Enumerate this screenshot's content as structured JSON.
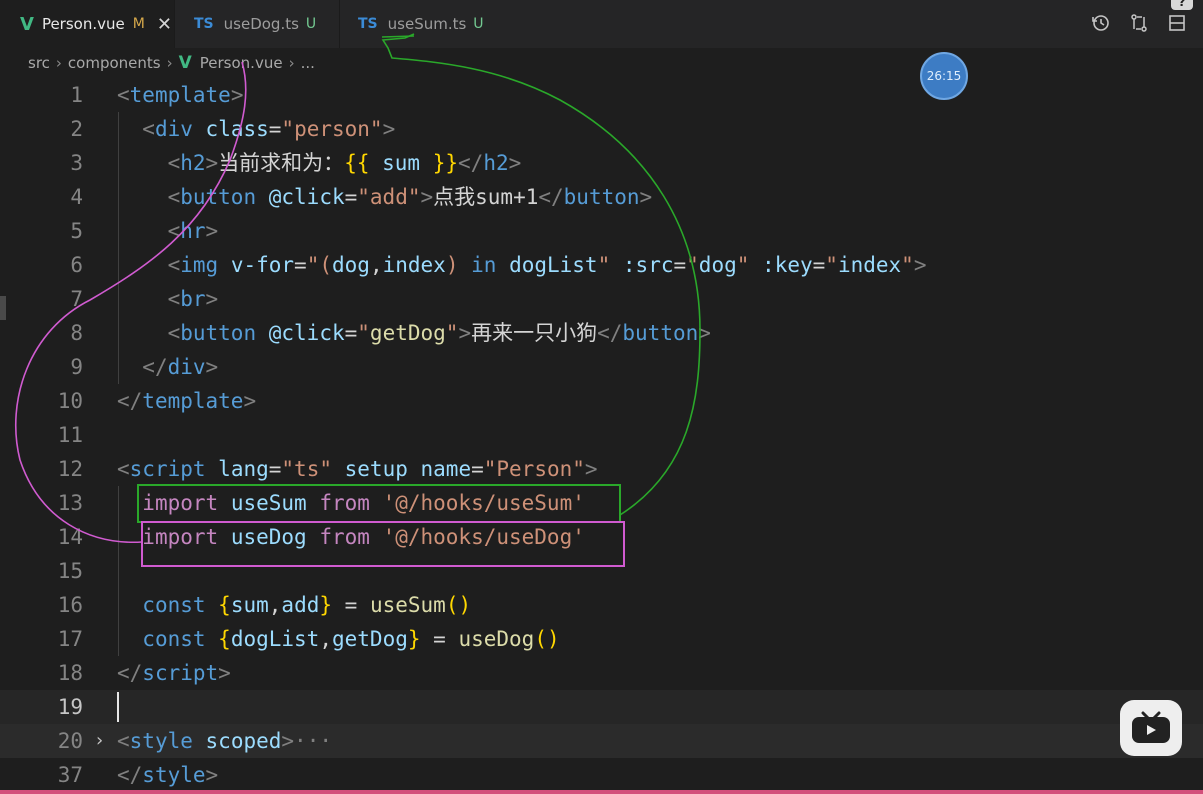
{
  "tabs": [
    {
      "icon": "V",
      "label": "Person.vue",
      "status": "M",
      "close": "✕",
      "active": true
    },
    {
      "icon": "TS",
      "label": "useDog.ts",
      "status": "U",
      "active": false
    },
    {
      "icon": "TS",
      "label": "useSum.ts",
      "status": "U",
      "active": false
    }
  ],
  "breadcrumb": {
    "parts": [
      "src",
      "components"
    ],
    "file_icon": "V",
    "file": "Person.vue",
    "ellipsis": "..."
  },
  "timer": "26:15",
  "corner_badge": "?",
  "toolbar": {
    "icons": [
      "history-icon",
      "compare-changes-icon",
      "split-editor-icon"
    ]
  },
  "editor": {
    "active_line": 19,
    "folded_line": 20,
    "fold_ellipsis": "···",
    "line_numbers": [
      "1",
      "2",
      "3",
      "4",
      "5",
      "6",
      "7",
      "8",
      "9",
      "10",
      "11",
      "12",
      "13",
      "14",
      "15",
      "16",
      "17",
      "18",
      "19",
      "20",
      "37"
    ]
  },
  "colors": {
    "highlight_green": "#2aa82a",
    "highlight_pink": "#d05bd0",
    "vue_green": "#41b883",
    "ts_blue": "#3b8bd6"
  },
  "code_lines": [
    [
      [
        "t",
        "<"
      ],
      [
        "tag",
        "template"
      ],
      [
        "t",
        ">"
      ]
    ],
    [
      [
        "tx",
        "  "
      ],
      [
        "t",
        "<"
      ],
      [
        "tag",
        "div"
      ],
      [
        "tx",
        " "
      ],
      [
        "at",
        "class"
      ],
      [
        "tx",
        "="
      ],
      [
        "st",
        "\"person\""
      ],
      [
        "t",
        ">"
      ]
    ],
    [
      [
        "tx",
        "    "
      ],
      [
        "t",
        "<"
      ],
      [
        "tag",
        "h2"
      ],
      [
        "t",
        ">"
      ],
      [
        "tx",
        "当前求和为："
      ],
      [
        "br",
        "{{"
      ],
      [
        "tx",
        " "
      ],
      [
        "vb",
        "sum"
      ],
      [
        "tx",
        " "
      ],
      [
        "br",
        "}}"
      ],
      [
        "t",
        "</"
      ],
      [
        "tag",
        "h2"
      ],
      [
        "t",
        ">"
      ]
    ],
    [
      [
        "tx",
        "    "
      ],
      [
        "t",
        "<"
      ],
      [
        "tag",
        "button"
      ],
      [
        "tx",
        " "
      ],
      [
        "at",
        "@click"
      ],
      [
        "tx",
        "="
      ],
      [
        "st",
        "\"add\""
      ],
      [
        "t",
        ">"
      ],
      [
        "tx",
        "点我sum+1"
      ],
      [
        "t",
        "</"
      ],
      [
        "tag",
        "button"
      ],
      [
        "t",
        ">"
      ]
    ],
    [
      [
        "tx",
        "    "
      ],
      [
        "t",
        "<"
      ],
      [
        "tag",
        "hr"
      ],
      [
        "t",
        ">"
      ]
    ],
    [
      [
        "tx",
        "    "
      ],
      [
        "t",
        "<"
      ],
      [
        "tag",
        "img"
      ],
      [
        "tx",
        " "
      ],
      [
        "at",
        "v-for"
      ],
      [
        "tx",
        "="
      ],
      [
        "st",
        "\"("
      ],
      [
        "vb",
        "dog"
      ],
      [
        "tx",
        ","
      ],
      [
        "vb",
        "index"
      ],
      [
        "st",
        ")"
      ],
      [
        "tx",
        " "
      ],
      [
        "cn",
        "in"
      ],
      [
        "tx",
        " "
      ],
      [
        "vb",
        "dogList"
      ],
      [
        "st",
        "\""
      ],
      [
        "tx",
        " "
      ],
      [
        "at",
        ":src"
      ],
      [
        "tx",
        "="
      ],
      [
        "st",
        "\""
      ],
      [
        "vb",
        "dog"
      ],
      [
        "st",
        "\""
      ],
      [
        "tx",
        " "
      ],
      [
        "at",
        ":key"
      ],
      [
        "tx",
        "="
      ],
      [
        "st",
        "\""
      ],
      [
        "vb",
        "index"
      ],
      [
        "st",
        "\""
      ],
      [
        "t",
        ">"
      ]
    ],
    [
      [
        "tx",
        "    "
      ],
      [
        "t",
        "<"
      ],
      [
        "tag",
        "br"
      ],
      [
        "t",
        ">"
      ]
    ],
    [
      [
        "tx",
        "    "
      ],
      [
        "t",
        "<"
      ],
      [
        "tag",
        "button"
      ],
      [
        "tx",
        " "
      ],
      [
        "at",
        "@click"
      ],
      [
        "tx",
        "="
      ],
      [
        "st",
        "\""
      ],
      [
        "fn",
        "getDog"
      ],
      [
        "st",
        "\""
      ],
      [
        "t",
        ">"
      ],
      [
        "tx",
        "再来一只小狗"
      ],
      [
        "t",
        "</"
      ],
      [
        "tag",
        "button"
      ],
      [
        "t",
        ">"
      ]
    ],
    [
      [
        "tx",
        "  "
      ],
      [
        "t",
        "</"
      ],
      [
        "tag",
        "div"
      ],
      [
        "t",
        ">"
      ]
    ],
    [
      [
        "t",
        "</"
      ],
      [
        "tag",
        "template"
      ],
      [
        "t",
        ">"
      ]
    ],
    [],
    [
      [
        "t",
        "<"
      ],
      [
        "tag",
        "script"
      ],
      [
        "tx",
        " "
      ],
      [
        "at",
        "lang"
      ],
      [
        "tx",
        "="
      ],
      [
        "st",
        "\"ts\""
      ],
      [
        "tx",
        " "
      ],
      [
        "at",
        "setup"
      ],
      [
        "tx",
        " "
      ],
      [
        "at",
        "name"
      ],
      [
        "tx",
        "="
      ],
      [
        "st",
        "\"Person\""
      ],
      [
        "t",
        ">"
      ]
    ],
    [
      [
        "tx",
        "  "
      ],
      [
        "kw",
        "import"
      ],
      [
        "tx",
        " "
      ],
      [
        "vb",
        "useSum"
      ],
      [
        "tx",
        " "
      ],
      [
        "kw",
        "from"
      ],
      [
        "tx",
        " "
      ],
      [
        "st",
        "'@/hooks/useSum'"
      ]
    ],
    [
      [
        "tx",
        "  "
      ],
      [
        "kw",
        "import"
      ],
      [
        "tx",
        " "
      ],
      [
        "vb",
        "useDog"
      ],
      [
        "tx",
        " "
      ],
      [
        "kw",
        "from"
      ],
      [
        "tx",
        " "
      ],
      [
        "st",
        "'@/hooks/useDog'"
      ]
    ],
    [],
    [
      [
        "tx",
        "  "
      ],
      [
        "cn",
        "const"
      ],
      [
        "tx",
        " "
      ],
      [
        "br",
        "{"
      ],
      [
        "vb",
        "sum"
      ],
      [
        "tx",
        ","
      ],
      [
        "vb",
        "add"
      ],
      [
        "br",
        "}"
      ],
      [
        "tx",
        " = "
      ],
      [
        "fn",
        "useSum"
      ],
      [
        "br",
        "()"
      ]
    ],
    [
      [
        "tx",
        "  "
      ],
      [
        "cn",
        "const"
      ],
      [
        "tx",
        " "
      ],
      [
        "br",
        "{"
      ],
      [
        "vb",
        "dogList"
      ],
      [
        "tx",
        ","
      ],
      [
        "vb",
        "getDog"
      ],
      [
        "br",
        "}"
      ],
      [
        "tx",
        " = "
      ],
      [
        "fn",
        "useDog"
      ],
      [
        "br",
        "()"
      ]
    ],
    [
      [
        "t",
        "</"
      ],
      [
        "tag",
        "script"
      ],
      [
        "t",
        ">"
      ]
    ],
    [],
    [
      [
        "t",
        "<"
      ],
      [
        "tag",
        "style"
      ],
      [
        "tx",
        " "
      ],
      [
        "at",
        "scoped"
      ],
      [
        "t",
        ">"
      ]
    ],
    [
      [
        "t",
        "</"
      ],
      [
        "tag",
        "style"
      ],
      [
        "t",
        ">"
      ]
    ]
  ]
}
